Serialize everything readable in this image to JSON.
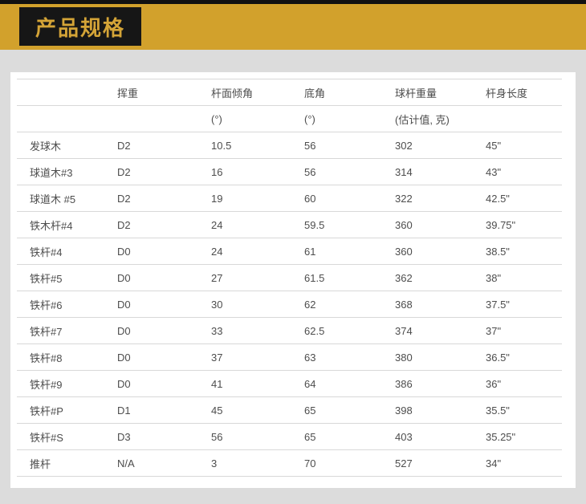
{
  "page": {
    "title": "产品规格",
    "colors": {
      "top_strip": "#111111",
      "banner_gold": "#d2a12c",
      "title_box_bg": "#161616",
      "title_text_gold": "#d4a437",
      "page_bg": "#dcdcdc",
      "card_bg": "#ffffff",
      "table_text": "#4d4d4d",
      "row_line": "#d8d8d8"
    }
  },
  "table": {
    "columns": [
      {
        "label": "",
        "sublabel": ""
      },
      {
        "label": "挥重",
        "sublabel": ""
      },
      {
        "label": "杆面倾角",
        "sublabel": "(°)"
      },
      {
        "label": "底角",
        "sublabel": "(°)"
      },
      {
        "label": "球杆重量",
        "sublabel": "(估计值, 克)"
      },
      {
        "label": "杆身长度",
        "sublabel": ""
      }
    ],
    "rows": [
      [
        "发球木",
        "D2",
        "10.5",
        "56",
        "302",
        "45\""
      ],
      [
        "球道木#3",
        "D2",
        "16",
        "56",
        "314",
        "43\""
      ],
      [
        "球道木 #5",
        "D2",
        "19",
        "60",
        "322",
        "42.5\""
      ],
      [
        "铁木杆#4",
        "D2",
        "24",
        "59.5",
        "360",
        "39.75\""
      ],
      [
        "铁杆#4",
        "D0",
        "24",
        "61",
        "360",
        "38.5\""
      ],
      [
        "铁杆#5",
        "D0",
        "27",
        "61.5",
        "362",
        "38\""
      ],
      [
        "铁杆#6",
        "D0",
        "30",
        "62",
        "368",
        "37.5\""
      ],
      [
        "铁杆#7",
        "D0",
        "33",
        "62.5",
        "374",
        "37\""
      ],
      [
        "铁杆#8",
        "D0",
        "37",
        "63",
        "380",
        "36.5\""
      ],
      [
        "铁杆#9",
        "D0",
        "41",
        "64",
        "386",
        "36\""
      ],
      [
        "铁杆#P",
        "D1",
        "45",
        "65",
        "398",
        "35.5\""
      ],
      [
        "铁杆#S",
        "D3",
        "56",
        "65",
        "403",
        "35.25\""
      ],
      [
        "推杆",
        "N/A",
        "3",
        "70",
        "527",
        "34\""
      ]
    ]
  }
}
